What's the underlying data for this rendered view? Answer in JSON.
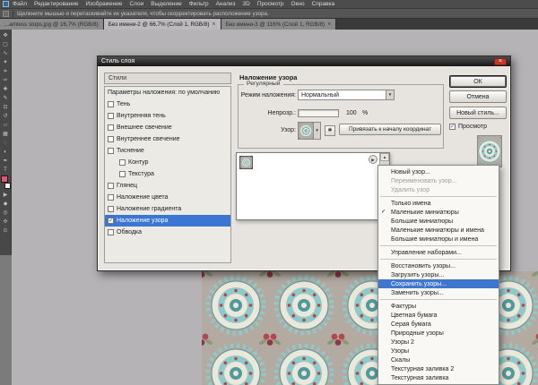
{
  "colors": {
    "highlight_blue": "#3b76d2",
    "menu_highlight": "#3f76cf",
    "dialog_bg": "#e7e4df",
    "close_red": "#c4372a",
    "canvas_gray": "#b6b3b6",
    "pattern_bg": "#b3aaa2",
    "pattern_teal": "#4f9a9c",
    "pattern_teal_light": "#8ecaca",
    "pattern_cream": "#ece7db",
    "pattern_red": "#b2484f",
    "pattern_red_dark": "#8e3a44",
    "pattern_leaf": "#8a9873",
    "foreground_swatch": "#e2566b"
  },
  "menu_bar": {
    "items": [
      "Файл",
      "Редактирование",
      "Изображение",
      "Слои",
      "Выделение",
      "Фильтр",
      "Анализ",
      "3D",
      "Просмотр",
      "Окно",
      "Справка"
    ]
  },
  "options_bar": {
    "hint": "Щелкните мышью и перетаскивайте их указателя, чтобы скорректировать расположение узора."
  },
  "tabs": [
    {
      "label": "...amless stops.jpg @ 16,7% (RGB/8)",
      "close": "",
      "active": false
    },
    {
      "label": "Без имени-2 @ 66,7% (Слой 1, RGB/8)",
      "close": "×",
      "active": true
    },
    {
      "label": "Без имени-3 @ 116% (Слой 1, RGB/8)",
      "close": "×",
      "active": false
    }
  ],
  "toolbar": {
    "tools": [
      {
        "name": "move-tool",
        "glyph": "✥"
      },
      {
        "name": "marquee-tool",
        "glyph": "▢"
      },
      {
        "name": "lasso-tool",
        "glyph": "∿"
      },
      {
        "name": "quick-selection-tool",
        "glyph": "✦"
      },
      {
        "name": "crop-tool",
        "glyph": "⌗"
      },
      {
        "name": "eyedropper-tool",
        "glyph": "✑"
      },
      {
        "name": "healing-brush-tool",
        "glyph": "✚"
      },
      {
        "name": "brush-tool",
        "glyph": "✎"
      },
      {
        "name": "clone-stamp-tool",
        "glyph": "⊡"
      },
      {
        "name": "history-brush-tool",
        "glyph": "↺"
      },
      {
        "name": "eraser-tool",
        "glyph": "▱"
      },
      {
        "name": "gradient-tool",
        "glyph": "▦"
      },
      {
        "name": "blur-tool",
        "glyph": "◌"
      },
      {
        "name": "dodge-tool",
        "glyph": "◐"
      },
      {
        "name": "pen-tool",
        "glyph": "✒"
      },
      {
        "name": "type-tool",
        "glyph": "T"
      },
      {
        "name": "path-selection-tool",
        "glyph": "▶"
      },
      {
        "name": "shape-tool",
        "glyph": "◆"
      },
      {
        "name": "rotate-view-tool",
        "glyph": "◎"
      },
      {
        "name": "hand-tool",
        "glyph": "✣"
      },
      {
        "name": "zoom-tool",
        "glyph": "⊙"
      }
    ]
  },
  "dialog": {
    "title": "Стиль слоя",
    "close": "×",
    "styles_header": "Стили",
    "style_items": [
      {
        "label": "Параметры наложения: по умолчанию",
        "checkbox": false,
        "checked": false,
        "indent": false,
        "selected": false
      },
      {
        "label": "Тень",
        "checkbox": true,
        "checked": false,
        "indent": false,
        "selected": false
      },
      {
        "label": "Внутренняя тень",
        "checkbox": true,
        "checked": false,
        "indent": false,
        "selected": false
      },
      {
        "label": "Внешнее свечение",
        "checkbox": true,
        "checked": false,
        "indent": false,
        "selected": false
      },
      {
        "label": "Внутреннее свечение",
        "checkbox": true,
        "checked": false,
        "indent": false,
        "selected": false
      },
      {
        "label": "Тиснение",
        "checkbox": true,
        "checked": false,
        "indent": false,
        "selected": false
      },
      {
        "label": "Контур",
        "checkbox": true,
        "checked": false,
        "indent": true,
        "selected": false
      },
      {
        "label": "Текстура",
        "checkbox": true,
        "checked": false,
        "indent": true,
        "selected": false
      },
      {
        "label": "Глянец",
        "checkbox": true,
        "checked": false,
        "indent": false,
        "selected": false
      },
      {
        "label": "Наложение цвета",
        "checkbox": true,
        "checked": false,
        "indent": false,
        "selected": false
      },
      {
        "label": "Наложение градиента",
        "checkbox": true,
        "checked": false,
        "indent": false,
        "selected": false
      },
      {
        "label": "Наложение узора",
        "checkbox": true,
        "checked": true,
        "indent": false,
        "selected": true
      },
      {
        "label": "Обводка",
        "checkbox": true,
        "checked": false,
        "indent": false,
        "selected": false
      }
    ],
    "panel": {
      "title": "Наложение узора",
      "group_legend": "Регулярный",
      "blend_mode_label": "Режим наложения:",
      "blend_mode_value": "Нормальный",
      "opacity_label": "Непрозр.:",
      "opacity_value": "100",
      "opacity_unit": "%",
      "pattern_label": "Узор:",
      "new_pattern_glyph": "✱",
      "snap_button_label": "Привязать к началу координат"
    },
    "buttons": {
      "ok": "ОК",
      "cancel": "Отмена",
      "new_style": "Новый стиль...",
      "preview_label": "Просмотр"
    }
  },
  "context_menu": {
    "items": [
      {
        "label": "Новый узор...",
        "state": "normal"
      },
      {
        "label": "Переименовать узор...",
        "state": "disabled"
      },
      {
        "label": "Удалить узор",
        "state": "disabled"
      },
      {
        "separator": true
      },
      {
        "label": "Только имена"
      },
      {
        "label": "Маленькие миниатюры",
        "checked": true
      },
      {
        "label": "Большие миниатюры"
      },
      {
        "label": "Маленькие миниатюры и имена"
      },
      {
        "label": "Большие миниатюры и имена"
      },
      {
        "separator": true
      },
      {
        "label": "Управление наборами..."
      },
      {
        "separator": true
      },
      {
        "label": "Восстановить узоры..."
      },
      {
        "label": "Загрузить узоры..."
      },
      {
        "label": "Сохранить узоры...",
        "highlighted": true
      },
      {
        "label": "Заменить узоры..."
      },
      {
        "separator": true
      },
      {
        "label": "Фактуры"
      },
      {
        "label": "Цветная бумага"
      },
      {
        "label": "Серая бумага"
      },
      {
        "label": "Природные узоры"
      },
      {
        "label": "Узоры 2"
      },
      {
        "label": "Узоры"
      },
      {
        "label": "Скалы"
      },
      {
        "label": "Текстурная заливка 2"
      },
      {
        "label": "Текстурная заливка"
      }
    ]
  }
}
